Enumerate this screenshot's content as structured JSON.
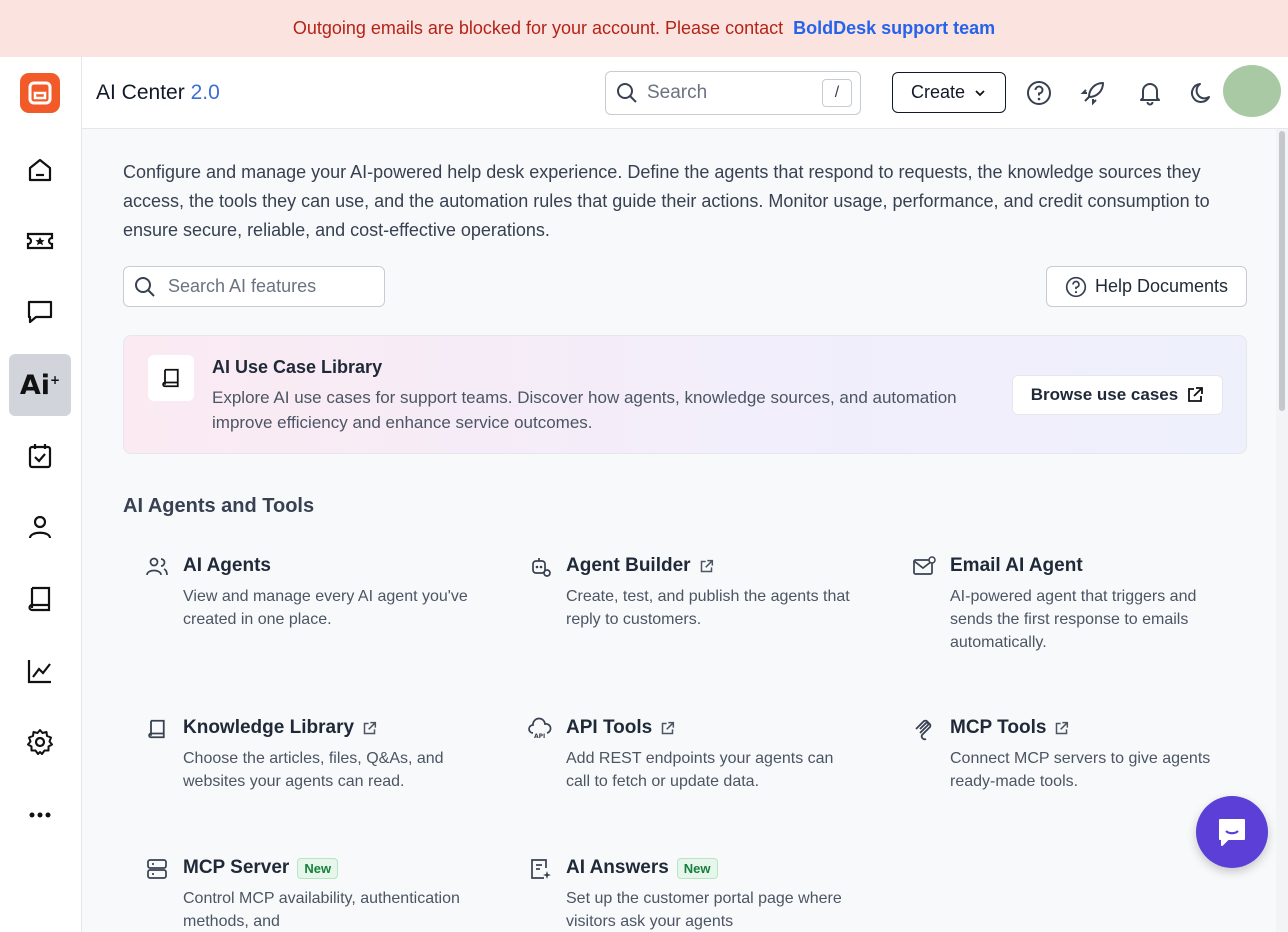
{
  "banner": {
    "message": "Outgoing emails are blocked for your account. Please contact",
    "link": "BoldDesk support team"
  },
  "sidebar": {
    "items": [
      {
        "icon": "home-icon"
      },
      {
        "icon": "ticket-icon"
      },
      {
        "icon": "chat-icon"
      },
      {
        "icon": "ai-icon",
        "label": "Ai",
        "active": true
      },
      {
        "icon": "calendar-check-icon"
      },
      {
        "icon": "user-icon"
      },
      {
        "icon": "book-icon"
      },
      {
        "icon": "analytics-icon"
      },
      {
        "icon": "settings-icon"
      },
      {
        "icon": "more-icon"
      }
    ]
  },
  "header": {
    "title": "AI Center",
    "version": "2.0",
    "search_placeholder": "Search",
    "search_shortcut": "/",
    "create_label": "Create"
  },
  "main": {
    "intro": "Configure and manage your AI-powered help desk experience. Define the agents that respond to requests, the knowledge sources they access, the tools they can use, and the automation rules that guide their actions. Monitor usage, performance, and credit consumption to ensure secure, reliable, and cost-effective operations.",
    "feature_search_placeholder": "Search AI features",
    "help_label": "Help Documents",
    "usecase": {
      "title": "AI Use Case Library",
      "description": "Explore AI use cases for support teams. Discover how agents, knowledge sources, and automation improve efficiency and enhance service outcomes.",
      "button": "Browse use cases"
    },
    "section_title": "AI Agents and Tools",
    "cards": [
      {
        "title": "AI Agents",
        "desc": "View and manage every AI agent you've created in one place.",
        "icon": "users-icon",
        "external": false
      },
      {
        "title": "Agent Builder",
        "desc": "Create, test, and publish the agents that reply to customers.",
        "icon": "robot-icon",
        "external": true
      },
      {
        "title": "Email AI Agent",
        "desc": "AI-powered agent that triggers and sends the first response to emails automatically.",
        "icon": "mail-icon",
        "external": false
      },
      {
        "title": "Knowledge Library",
        "desc": "Choose the articles, files, Q&As, and websites your agents can read.",
        "icon": "book-icon",
        "external": true
      },
      {
        "title": "API Tools",
        "desc": "Add REST endpoints your agents can call to fetch or update data.",
        "icon": "api-cloud-icon",
        "external": true
      },
      {
        "title": "MCP Tools",
        "desc": "Connect MCP servers to give agents ready-made tools.",
        "icon": "mcp-icon",
        "external": true
      },
      {
        "title": "MCP Server",
        "desc": "Control MCP availability, authentication methods, and",
        "icon": "server-icon",
        "badge": "New"
      },
      {
        "title": "AI Answers",
        "desc": "Set up the customer portal page where visitors ask your agents",
        "icon": "doc-sparkle-icon",
        "badge": "New"
      }
    ]
  }
}
